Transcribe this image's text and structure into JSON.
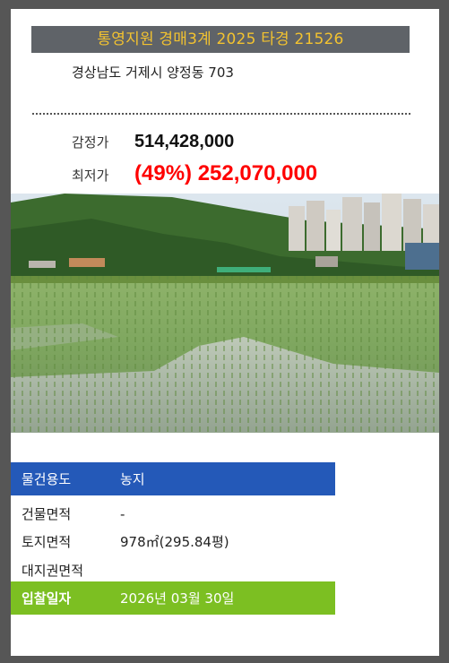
{
  "header": {
    "title": "통영지원 경매3계 2025 타경 21526",
    "address": "경상남도 거제시 양정동 703"
  },
  "prices": {
    "appraisal_label": "감정가",
    "appraisal_value": "514,428,000",
    "minimum_label": "최저가",
    "minimum_value": "(49%) 252,070,000"
  },
  "photo": {
    "description_icon": "rice-paddy-photo"
  },
  "details": {
    "usage_label": "물건용도",
    "usage_value": "농지",
    "building_area_label": "건물면적",
    "building_area_value": "-",
    "land_area_label": "토지면적",
    "land_area_value": "978㎡(295.84평)",
    "site_area_label": "대지권면적",
    "site_area_value": "",
    "bid_date_label": "입찰일자",
    "bid_date_value": "2026년 03월 30일"
  },
  "colors": {
    "title_bg": "#5f6368",
    "title_text": "#f2c230",
    "minimum_price": "#ff0000",
    "usage_row_bg": "#2459b8",
    "bid_row_bg": "#7cbf22"
  }
}
